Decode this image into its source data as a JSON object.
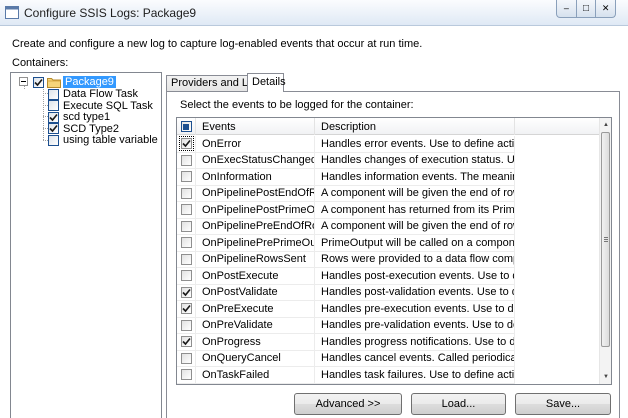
{
  "window": {
    "title": "Configure SSIS Logs: Package9",
    "minimize_glyph": "–",
    "maximize_glyph": "□",
    "close_glyph": "✕"
  },
  "description": "Create and configure a new log to capture log-enabled events that occur at run time.",
  "containers_label": "Containers:",
  "tree": {
    "root": {
      "label": "Package9",
      "checked": true,
      "icon": "folder-icon"
    },
    "children": [
      {
        "label": "Data Flow Task",
        "checked": false
      },
      {
        "label": "Execute SQL Task",
        "checked": false
      },
      {
        "label": "scd type1",
        "checked": true
      },
      {
        "label": "SCD Type2",
        "checked": true
      },
      {
        "label": "using table variable",
        "checked": false
      }
    ]
  },
  "tabs": [
    {
      "label": "Providers and Logs",
      "active": false
    },
    {
      "label": "Details",
      "active": true
    }
  ],
  "details": {
    "instruction": "Select the events to be logged for the container:",
    "columns": {
      "events": "Events",
      "description": "Description"
    },
    "header_checked": true,
    "rows": [
      {
        "event": "OnError",
        "description": "Handles error events. Use to define actions to p",
        "checked": true
      },
      {
        "event": "OnExecStatusChanged",
        "description": "Handles changes of execution status. Use to def",
        "checked": false
      },
      {
        "event": "OnInformation",
        "description": "Handles information events. The meanings of i...",
        "checked": false
      },
      {
        "event": "OnPipelinePostEndOfRows...",
        "description": "A component will be given the end of rowset si...",
        "checked": false
      },
      {
        "event": "OnPipelinePostPrimeOutput",
        "description": "A component has returned from its PrimeOutp...",
        "checked": false
      },
      {
        "event": "OnPipelinePreEndOfRowset",
        "description": "A component will be given the end of rowset si...",
        "checked": false
      },
      {
        "event": "OnPipelinePrePrimeOutput",
        "description": "PrimeOutput will be called on a component.",
        "checked": false
      },
      {
        "event": "OnPipelineRowsSent",
        "description": "Rows were provided to a data flow component ...",
        "checked": false
      },
      {
        "event": "OnPostExecute",
        "description": "Handles post-execution events. Use to define p...",
        "checked": false
      },
      {
        "event": "OnPostValidate",
        "description": "Handles post-validation events. Use to define p...",
        "checked": true
      },
      {
        "event": "OnPreExecute",
        "description": "Handles pre-execution events. Use to define pre...",
        "checked": true
      },
      {
        "event": "OnPreValidate",
        "description": "Handles pre-validation events. Use to define pre",
        "checked": false
      },
      {
        "event": "OnProgress",
        "description": "Handles progress notifications. Use to define ac...",
        "checked": true
      },
      {
        "event": "OnQueryCancel",
        "description": "Handles cancel events. Called periodically to de...",
        "checked": false
      },
      {
        "event": "OnTaskFailed",
        "description": "Handles task failures. Use to define actions to p...",
        "checked": false
      }
    ]
  },
  "buttons": {
    "advanced": "Advanced >>",
    "load": "Load...",
    "save": "Save..."
  }
}
